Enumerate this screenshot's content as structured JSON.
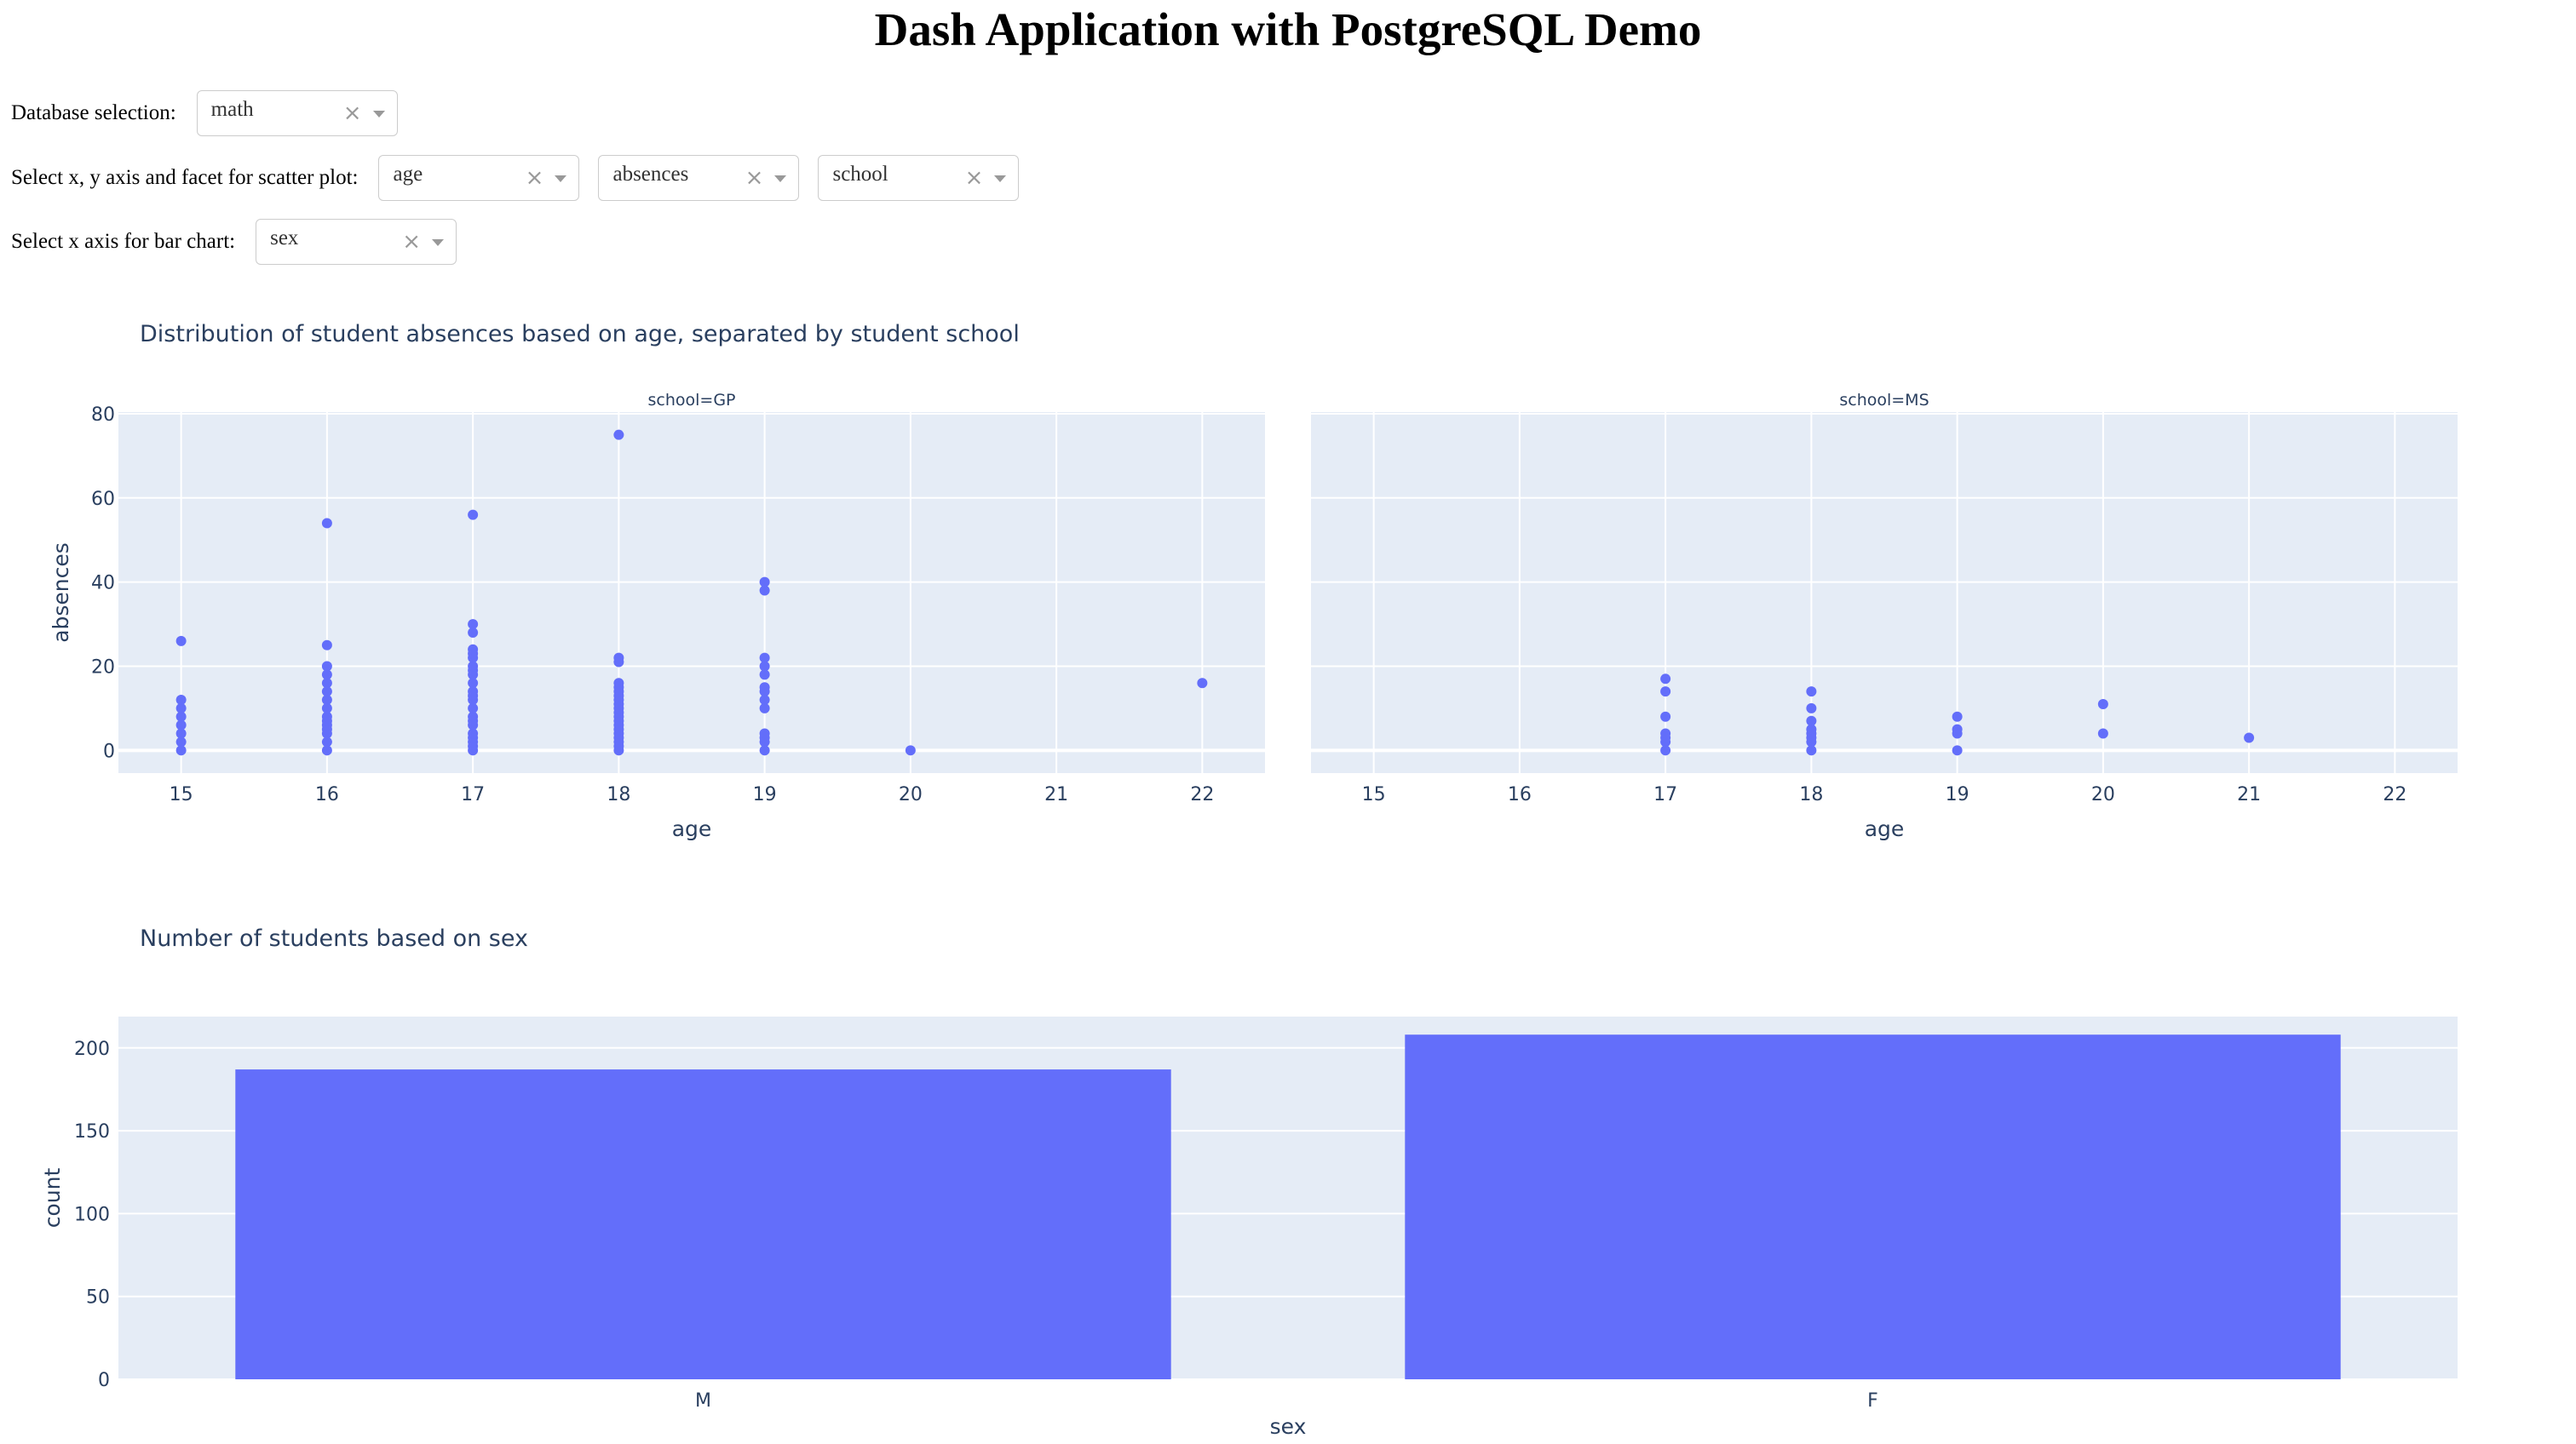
{
  "header": {
    "title": "Dash Application with PostgreSQL Demo"
  },
  "controls": {
    "database": {
      "label": "Database selection:",
      "value": "math"
    },
    "scatter": {
      "label": "Select x, y axis and facet for scatter plot:",
      "x_value": "age",
      "y_value": "absences",
      "facet_value": "school"
    },
    "bar": {
      "label": "Select x axis for bar chart:",
      "value": "sex"
    },
    "clear_icon": "×"
  },
  "colors": {
    "marker": "#636efa",
    "plot_bg": "#e5ecf6",
    "grid": "#ffffff",
    "text": "#2a3f5f"
  },
  "chart_data": [
    {
      "type": "scatter",
      "title": "Distribution of student absences based on age, separated by student school",
      "xlabel": "age",
      "ylabel": "absences",
      "facet_by": "school",
      "xlim": [
        14.57,
        22.43
      ],
      "ylim": [
        -5.4,
        80.4
      ],
      "xticks": [
        15,
        16,
        17,
        18,
        19,
        20,
        21,
        22
      ],
      "yticks": [
        0,
        20,
        40,
        60,
        80
      ],
      "grid": true,
      "facets": [
        {
          "label": "school=GP",
          "points": [
            [
              15,
              0
            ],
            [
              15,
              2
            ],
            [
              15,
              4
            ],
            [
              15,
              6
            ],
            [
              15,
              8
            ],
            [
              15,
              10
            ],
            [
              15,
              12
            ],
            [
              15,
              26
            ],
            [
              16,
              0
            ],
            [
              16,
              2
            ],
            [
              16,
              4
            ],
            [
              16,
              5
            ],
            [
              16,
              6
            ],
            [
              16,
              7
            ],
            [
              16,
              8
            ],
            [
              16,
              10
            ],
            [
              16,
              12
            ],
            [
              16,
              14
            ],
            [
              16,
              16
            ],
            [
              16,
              18
            ],
            [
              16,
              20
            ],
            [
              16,
              25
            ],
            [
              16,
              54
            ],
            [
              17,
              0
            ],
            [
              17,
              1
            ],
            [
              17,
              2
            ],
            [
              17,
              3
            ],
            [
              17,
              4
            ],
            [
              17,
              6
            ],
            [
              17,
              7
            ],
            [
              17,
              8
            ],
            [
              17,
              10
            ],
            [
              17,
              12
            ],
            [
              17,
              13
            ],
            [
              17,
              14
            ],
            [
              17,
              16
            ],
            [
              17,
              18
            ],
            [
              17,
              19
            ],
            [
              17,
              20
            ],
            [
              17,
              22
            ],
            [
              17,
              23
            ],
            [
              17,
              24
            ],
            [
              17,
              28
            ],
            [
              17,
              30
            ],
            [
              17,
              56
            ],
            [
              18,
              0
            ],
            [
              18,
              1
            ],
            [
              18,
              2
            ],
            [
              18,
              3
            ],
            [
              18,
              4
            ],
            [
              18,
              5
            ],
            [
              18,
              6
            ],
            [
              18,
              7
            ],
            [
              18,
              8
            ],
            [
              18,
              9
            ],
            [
              18,
              10
            ],
            [
              18,
              11
            ],
            [
              18,
              12
            ],
            [
              18,
              13
            ],
            [
              18,
              14
            ],
            [
              18,
              15
            ],
            [
              18,
              16
            ],
            [
              18,
              21
            ],
            [
              18,
              22
            ],
            [
              18,
              75
            ],
            [
              19,
              0
            ],
            [
              19,
              2
            ],
            [
              19,
              3
            ],
            [
              19,
              4
            ],
            [
              19,
              10
            ],
            [
              19,
              12
            ],
            [
              19,
              14
            ],
            [
              19,
              15
            ],
            [
              19,
              18
            ],
            [
              19,
              20
            ],
            [
              19,
              22
            ],
            [
              19,
              38
            ],
            [
              19,
              40
            ],
            [
              20,
              0
            ],
            [
              22,
              16
            ]
          ]
        },
        {
          "label": "school=MS",
          "points": [
            [
              17,
              0
            ],
            [
              17,
              2
            ],
            [
              17,
              3
            ],
            [
              17,
              4
            ],
            [
              17,
              8
            ],
            [
              17,
              14
            ],
            [
              17,
              17
            ],
            [
              18,
              0
            ],
            [
              18,
              2
            ],
            [
              18,
              3
            ],
            [
              18,
              4
            ],
            [
              18,
              5
            ],
            [
              18,
              7
            ],
            [
              18,
              10
            ],
            [
              18,
              14
            ],
            [
              19,
              0
            ],
            [
              19,
              4
            ],
            [
              19,
              5
            ],
            [
              19,
              8
            ],
            [
              20,
              4
            ],
            [
              20,
              11
            ],
            [
              21,
              3
            ]
          ]
        }
      ]
    },
    {
      "type": "bar",
      "title": "Number of students based on sex",
      "xlabel": "sex",
      "ylabel": "count",
      "categories": [
        "M",
        "F"
      ],
      "values": [
        187,
        208
      ],
      "ylim": [
        0,
        218.9
      ],
      "yticks": [
        0,
        50,
        100,
        150,
        200
      ],
      "grid": true
    }
  ]
}
